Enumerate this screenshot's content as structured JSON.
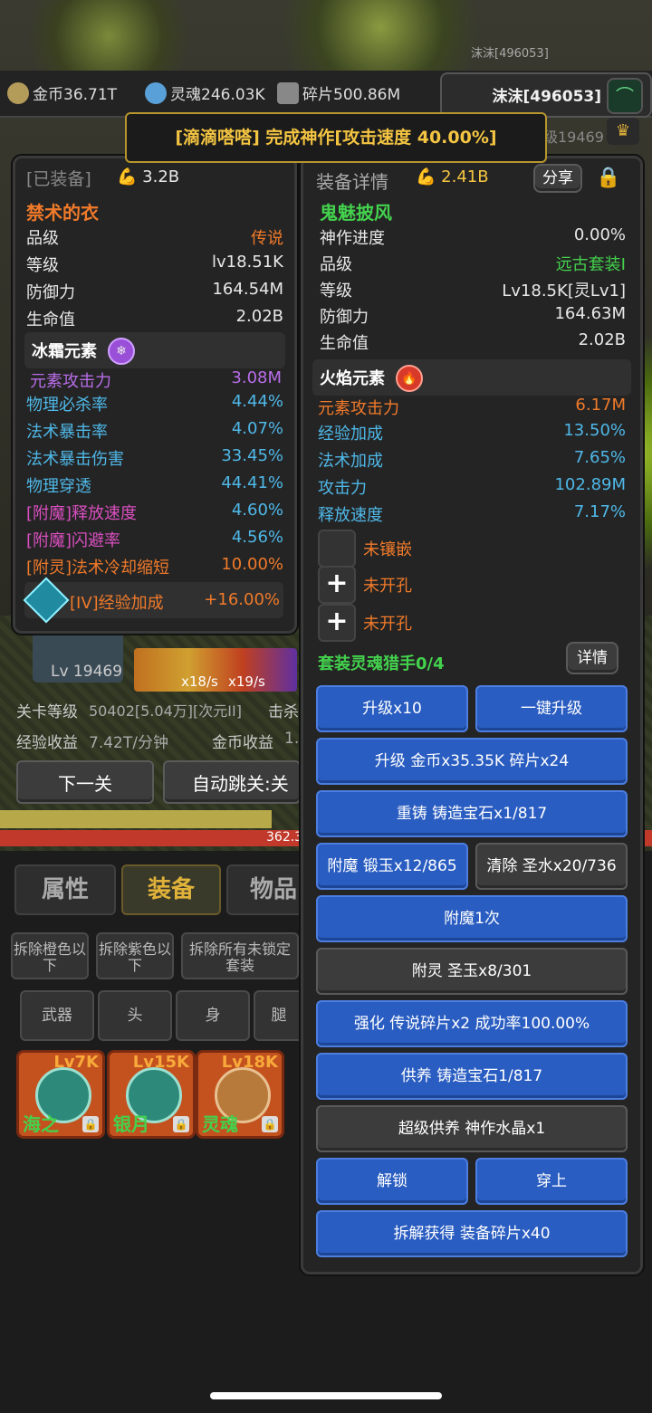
{
  "header": {
    "top_user": "沫沫[496053]",
    "gold": "金币36.71T",
    "soul": "灵魂246.03K",
    "fragments": "碎片500.86M",
    "user_name": "沫沫[496053]",
    "rank": "等级19469"
  },
  "notice": "[滴滴嗒嗒] 完成神作[攻击速度 40.00%]",
  "left_panel": {
    "tag": "[已装备]",
    "power": "3.2B",
    "name": "禁术的衣",
    "stats": [
      {
        "label": "品级",
        "value": "传说",
        "color": "#f07a2a"
      },
      {
        "label": "等级",
        "value": "lv18.51K",
        "color": "#e8e8e8"
      },
      {
        "label": "防御力",
        "value": "164.54M",
        "color": "#e8e8e8"
      },
      {
        "label": "生命值",
        "value": "2.02B",
        "color": "#e8e8e8"
      }
    ],
    "element_title": "冰霜元素",
    "element_stat": {
      "label": "元素攻击力",
      "value": "3.08M",
      "color": "#b86de8"
    },
    "extra": [
      {
        "label": "物理必杀率",
        "value": "4.44%",
        "lc": "#4fb8e8",
        "vc": "#4fb8e8"
      },
      {
        "label": "法术暴击率",
        "value": "4.07%",
        "lc": "#4fb8e8",
        "vc": "#4fb8e8"
      },
      {
        "label": "法术暴击伤害",
        "value": "33.45%",
        "lc": "#4fb8e8",
        "vc": "#4fb8e8"
      },
      {
        "label": "物理穿透",
        "value": "44.41%",
        "lc": "#4fb8e8",
        "vc": "#4fb8e8"
      },
      {
        "label": "[附魔]释放速度",
        "value": "4.60%",
        "lc": "#d94fc0",
        "vc": "#4fb8e8"
      },
      {
        "label": "[附魔]闪避率",
        "value": "4.56%",
        "lc": "#d94fc0",
        "vc": "#4fb8e8"
      },
      {
        "label": "[附灵]法术冷却缩短",
        "value": "10.00%",
        "lc": "#f07a2a",
        "vc": "#f07a2a"
      }
    ],
    "gem_label": "[IV]经验加成",
    "gem_value": "+16.00%"
  },
  "right_panel": {
    "title": "装备详情",
    "power": "2.41B",
    "share": "分享",
    "name": "鬼魅披风",
    "stats": [
      {
        "label": "神作进度",
        "value": "0.00%",
        "color": "#e8e8e8"
      },
      {
        "label": "品级",
        "value": "远古套装I",
        "color": "#43d14d"
      },
      {
        "label": "等级",
        "value": "Lv18.5K[灵Lv1]",
        "color": "#e8e8e8"
      },
      {
        "label": "防御力",
        "value": "164.63M",
        "color": "#e8e8e8"
      },
      {
        "label": "生命值",
        "value": "2.02B",
        "color": "#e8e8e8"
      }
    ],
    "element_title": "火焰元素",
    "element_stat": {
      "label": "元素攻击力",
      "value": "6.17M",
      "color": "#f07a2a"
    },
    "extra": [
      {
        "label": "经验加成",
        "value": "13.50%"
      },
      {
        "label": "法术加成",
        "value": "7.65%"
      },
      {
        "label": "攻击力",
        "value": "102.89M"
      },
      {
        "label": "释放速度",
        "value": "7.17%"
      }
    ],
    "sockets": [
      "未镶嵌",
      "未开孔",
      "未开孔"
    ],
    "set_title": "套装灵魂猎手0/4",
    "detail_button": "详情",
    "buttons": {
      "upgrade10": "升级x10",
      "one_key": "一键升级",
      "upgrade_cost": "升级 金币x35.35K 碎片x24",
      "recast": "重铸 铸造宝石x1/817",
      "enchant": "附魔 锻玉x12/865",
      "clear": "清除 圣水x20/736",
      "enchant_once": "附魔1次",
      "spirit": "附灵 圣玉x8/301",
      "strengthen": "强化 传说碎片x2 成功率100.00%",
      "nurture": "供养 铸造宝石1/817",
      "super_nurture": "超级供养 神作水晶x1",
      "unlock": "解锁",
      "wear": "穿上",
      "dismantle": "拆解获得 装备碎片x40"
    }
  },
  "game": {
    "lv": "Lv 19469",
    "speed1": "x18/s",
    "speed2": "x19/s",
    "stage_label": "关卡等级",
    "stage_value": "50402[5.04万][次元II]",
    "kill": "击杀",
    "exp_label": "经验收益",
    "exp_value": "7.42T/分钟",
    "gold_label": "金币收益",
    "gold_value": "1.",
    "next": "下一关",
    "auto": "自动跳关:关",
    "bar_text": "362.3"
  },
  "tabs": [
    "属性",
    "装备",
    "物品"
  ],
  "filters": [
    "拆除橙色以下",
    "拆除紫色以下",
    "拆除所有未锁定套装"
  ],
  "slots": [
    "武器",
    "头",
    "身",
    "腿"
  ],
  "items": [
    {
      "lv": "Lv7K",
      "name": "海之"
    },
    {
      "lv": "Lv15K",
      "name": "银月"
    },
    {
      "lv": "Lv18K",
      "name": "灵魂"
    }
  ]
}
